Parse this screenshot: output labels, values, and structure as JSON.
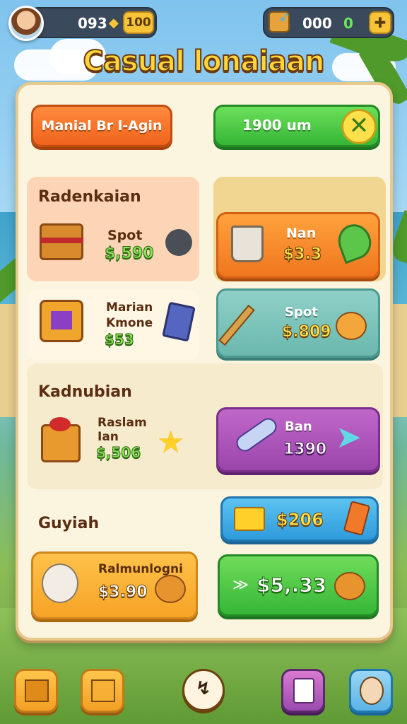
{
  "hud": {
    "left_value": "093",
    "left_badge": "100",
    "right_value": "000",
    "right_green": "0"
  },
  "title": "Casual lonaiaan",
  "top_buttons": {
    "manual": "Manial Br l-Agin",
    "timer": "1900 um"
  },
  "sections": [
    {
      "title": "Radenkaian",
      "items": [
        {
          "name": "Spot",
          "price": "$,590"
        },
        {
          "name": "Nan",
          "price": "$3.3"
        },
        {
          "name": "Marian Kmone",
          "price": "$53"
        },
        {
          "name": "Spot",
          "price": "$.809"
        }
      ]
    },
    {
      "title": "Kadnubian",
      "items": [
        {
          "name": "Raslam Ian",
          "price": "$,506"
        },
        {
          "name": "Ban",
          "price": "1390"
        }
      ]
    },
    {
      "title": "Guyiah",
      "items": [
        {
          "name": "",
          "price": "$206"
        },
        {
          "name": "Ralmunlogni",
          "price": "$3.90"
        },
        {
          "name": "",
          "price": "$5,.33"
        }
      ]
    }
  ],
  "colors": {
    "orange": "#f0761e",
    "green": "#36b637",
    "purple": "#9b45ab",
    "teal": "#6bb8ae",
    "blue": "#2e9bdc",
    "panel": "#fbf4df"
  }
}
